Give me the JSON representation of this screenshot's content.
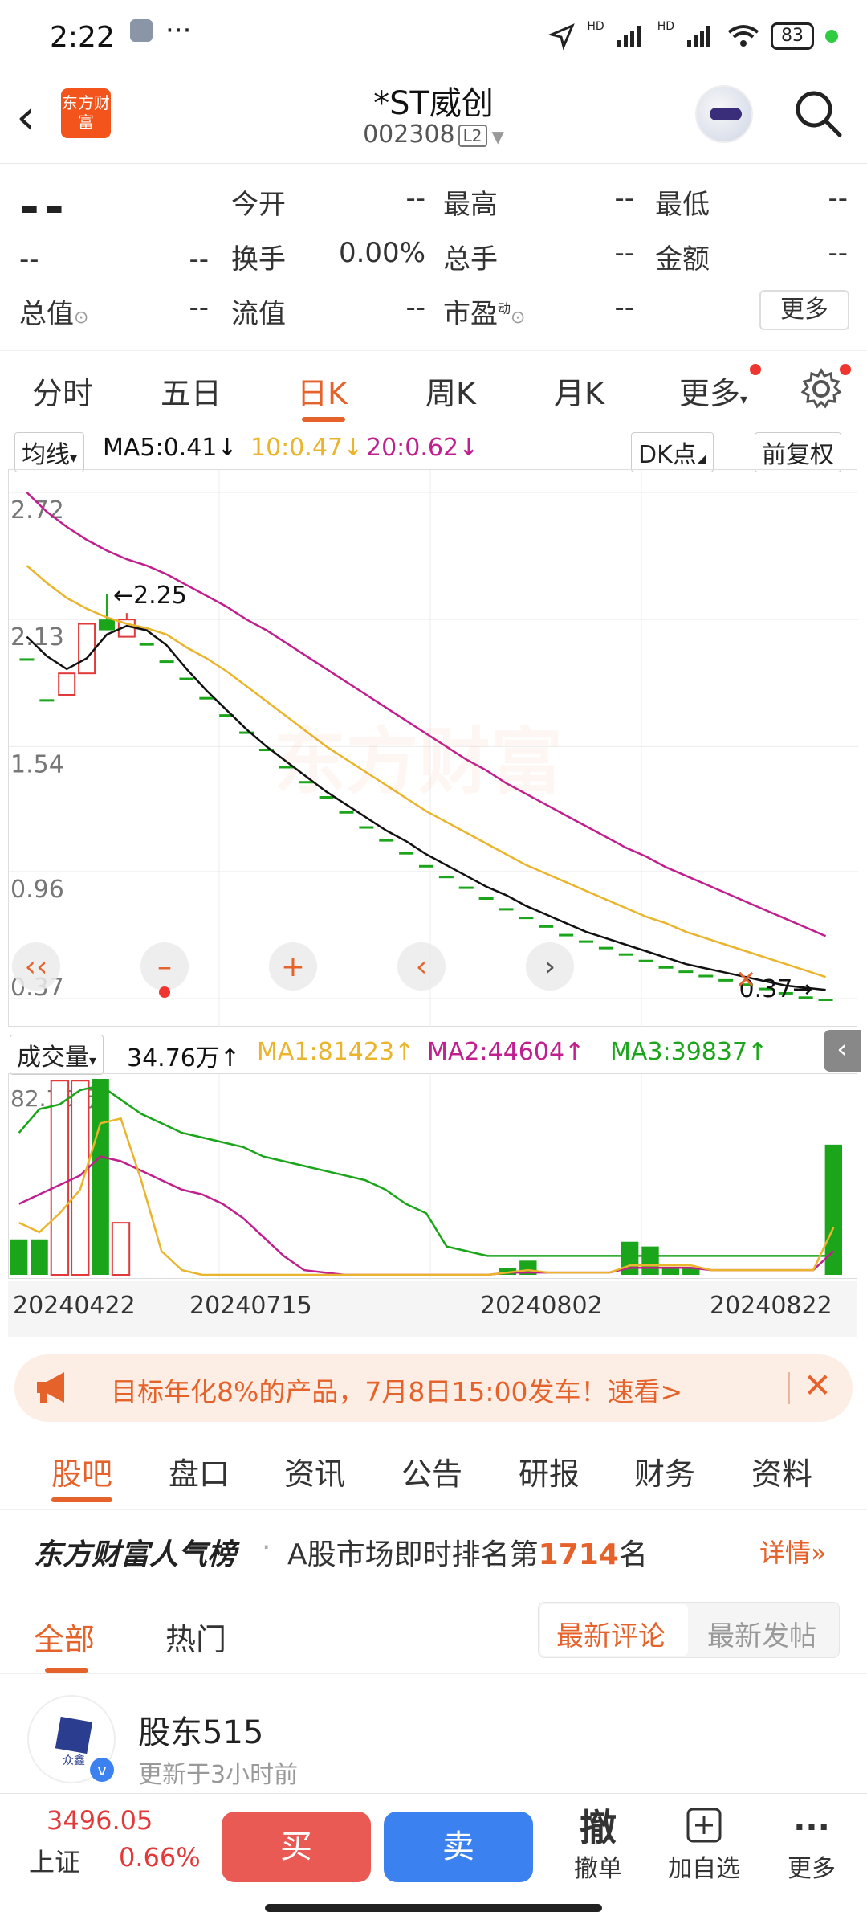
{
  "status": {
    "time": "2:22",
    "dots": "···",
    "battery": "83",
    "hd1": "HD",
    "hd2": "HD"
  },
  "header": {
    "title": "*ST威创",
    "code": "002308",
    "level": "L2",
    "logo_text": "东方财富"
  },
  "quote": {
    "price": "--",
    "change": "--",
    "change_pct": "--",
    "open_label": "今开",
    "open": "--",
    "high_label": "最高",
    "high": "--",
    "low_label": "最低",
    "low": "--",
    "turnover_label": "换手",
    "turnover": "0.00%",
    "volume_label": "总手",
    "volume": "--",
    "amount_label": "金额",
    "amount": "--",
    "mktcap_label": "总值",
    "mktcap": "--",
    "float_label": "流值",
    "float": "--",
    "pe_label": "市盈",
    "pe_sup": "动",
    "pe": "--",
    "more": "更多"
  },
  "tabs": [
    "分时",
    "五日",
    "日K",
    "周K",
    "月K",
    "更多"
  ],
  "active_tab": "日K",
  "ma": {
    "selector": "均线",
    "ma5": "MA5:0.41",
    "ma10": "10:0.47",
    "ma20": "20:0.62",
    "dk": "DK点",
    "adjust": "前复权"
  },
  "volume_ind": {
    "selector": "成交量",
    "vol": "34.76万",
    "ma1": "MA1:81423",
    "ma2": "MA2:44604",
    "ma3": "MA3:39837",
    "max_label": "82.76万"
  },
  "colors": {
    "accent": "#e6622b",
    "up": "#e2393a",
    "down": "#1aa51a",
    "ma5": "#111111",
    "ma10": "#eab52c",
    "ma20": "#c0208e"
  },
  "chart_data": {
    "type": "candlestick",
    "y_ticks": [
      "2.72",
      "2.13",
      "1.54",
      "0.96",
      "0.37"
    ],
    "ylim": [
      0.37,
      2.72
    ],
    "high_marker": "2.25",
    "low_marker": "0.37",
    "x_dates": [
      "20240422",
      "20240715",
      "20240802",
      "20240822"
    ],
    "candles": [
      {
        "o": 1.95,
        "c": 1.95,
        "h": 1.95,
        "l": 1.95,
        "up": false
      },
      {
        "o": 1.76,
        "c": 1.76,
        "h": 1.76,
        "l": 1.76,
        "up": false
      },
      {
        "o": 1.78,
        "c": 1.88,
        "h": 1.88,
        "l": 1.78,
        "up": true
      },
      {
        "o": 1.88,
        "c": 2.11,
        "h": 2.11,
        "l": 1.88,
        "up": true
      },
      {
        "o": 2.13,
        "c": 2.08,
        "h": 2.25,
        "l": 2.08,
        "up": false
      },
      {
        "o": 2.05,
        "c": 2.13,
        "h": 2.16,
        "l": 2.05,
        "up": true
      },
      {
        "o": 2.02,
        "c": 2.02,
        "h": 2.02,
        "l": 2.02,
        "up": false
      },
      {
        "o": 1.94,
        "c": 1.94,
        "h": 1.94,
        "l": 1.94,
        "up": false
      },
      {
        "o": 1.86,
        "c": 1.86,
        "h": 1.86,
        "l": 1.86,
        "up": false
      },
      {
        "o": 1.77,
        "c": 1.77,
        "h": 1.77,
        "l": 1.77,
        "up": false
      },
      {
        "o": 1.69,
        "c": 1.69,
        "h": 1.69,
        "l": 1.69,
        "up": false
      },
      {
        "o": 1.61,
        "c": 1.61,
        "h": 1.61,
        "l": 1.61,
        "up": false
      },
      {
        "o": 1.53,
        "c": 1.53,
        "h": 1.53,
        "l": 1.53,
        "up": false
      },
      {
        "o": 1.45,
        "c": 1.45,
        "h": 1.45,
        "l": 1.45,
        "up": false
      },
      {
        "o": 1.38,
        "c": 1.38,
        "h": 1.38,
        "l": 1.38,
        "up": false
      },
      {
        "o": 1.31,
        "c": 1.31,
        "h": 1.31,
        "l": 1.31,
        "up": false
      },
      {
        "o": 1.24,
        "c": 1.24,
        "h": 1.24,
        "l": 1.24,
        "up": false
      },
      {
        "o": 1.17,
        "c": 1.17,
        "h": 1.17,
        "l": 1.17,
        "up": false
      },
      {
        "o": 1.11,
        "c": 1.11,
        "h": 1.11,
        "l": 1.11,
        "up": false
      },
      {
        "o": 1.05,
        "c": 1.05,
        "h": 1.05,
        "l": 1.05,
        "up": false
      },
      {
        "o": 0.99,
        "c": 0.99,
        "h": 0.99,
        "l": 0.99,
        "up": false
      },
      {
        "o": 0.94,
        "c": 0.94,
        "h": 0.94,
        "l": 0.94,
        "up": false
      },
      {
        "o": 0.89,
        "c": 0.89,
        "h": 0.89,
        "l": 0.89,
        "up": false
      },
      {
        "o": 0.84,
        "c": 0.84,
        "h": 0.84,
        "l": 0.84,
        "up": false
      },
      {
        "o": 0.79,
        "c": 0.79,
        "h": 0.79,
        "l": 0.79,
        "up": false
      },
      {
        "o": 0.75,
        "c": 0.75,
        "h": 0.75,
        "l": 0.75,
        "up": false
      },
      {
        "o": 0.71,
        "c": 0.71,
        "h": 0.71,
        "l": 0.71,
        "up": false
      },
      {
        "o": 0.67,
        "c": 0.67,
        "h": 0.67,
        "l": 0.67,
        "up": false
      },
      {
        "o": 0.64,
        "c": 0.64,
        "h": 0.64,
        "l": 0.64,
        "up": false
      },
      {
        "o": 0.61,
        "c": 0.61,
        "h": 0.61,
        "l": 0.61,
        "up": false
      },
      {
        "o": 0.58,
        "c": 0.58,
        "h": 0.58,
        "l": 0.58,
        "up": false
      },
      {
        "o": 0.55,
        "c": 0.55,
        "h": 0.55,
        "l": 0.55,
        "up": false
      },
      {
        "o": 0.52,
        "c": 0.52,
        "h": 0.52,
        "l": 0.52,
        "up": false
      },
      {
        "o": 0.5,
        "c": 0.5,
        "h": 0.5,
        "l": 0.5,
        "up": false
      },
      {
        "o": 0.48,
        "c": 0.48,
        "h": 0.48,
        "l": 0.48,
        "up": false
      },
      {
        "o": 0.46,
        "c": 0.46,
        "h": 0.46,
        "l": 0.46,
        "up": false
      },
      {
        "o": 0.44,
        "c": 0.44,
        "h": 0.44,
        "l": 0.44,
        "up": false
      },
      {
        "o": 0.42,
        "c": 0.42,
        "h": 0.42,
        "l": 0.42,
        "up": false
      },
      {
        "o": 0.4,
        "c": 0.4,
        "h": 0.4,
        "l": 0.4,
        "up": false
      },
      {
        "o": 0.38,
        "c": 0.38,
        "h": 0.38,
        "l": 0.38,
        "up": false
      },
      {
        "o": 0.37,
        "c": 0.37,
        "h": 0.37,
        "l": 0.37,
        "up": false
      }
    ],
    "ma5": [
      2.05,
      1.96,
      1.9,
      1.95,
      2.06,
      2.1,
      2.08,
      2.01,
      1.9,
      1.8,
      1.71,
      1.62,
      1.54,
      1.47,
      1.4,
      1.33,
      1.27,
      1.21,
      1.15,
      1.1,
      1.04,
      0.99,
      0.94,
      0.89,
      0.85,
      0.8,
      0.76,
      0.72,
      0.68,
      0.65,
      0.62,
      0.59,
      0.56,
      0.53,
      0.51,
      0.49,
      0.47,
      0.45,
      0.43,
      0.42,
      0.41
    ],
    "ma10": [
      2.38,
      2.3,
      2.23,
      2.18,
      2.14,
      2.11,
      2.09,
      2.06,
      2.0,
      1.95,
      1.89,
      1.82,
      1.75,
      1.68,
      1.61,
      1.54,
      1.48,
      1.42,
      1.36,
      1.3,
      1.24,
      1.19,
      1.14,
      1.09,
      1.04,
      0.99,
      0.95,
      0.91,
      0.87,
      0.83,
      0.79,
      0.75,
      0.72,
      0.68,
      0.65,
      0.62,
      0.59,
      0.56,
      0.53,
      0.5,
      0.47
    ],
    "ma20": [
      2.72,
      2.63,
      2.56,
      2.5,
      2.45,
      2.41,
      2.38,
      2.34,
      2.29,
      2.24,
      2.19,
      2.13,
      2.08,
      2.02,
      1.96,
      1.9,
      1.84,
      1.78,
      1.72,
      1.66,
      1.6,
      1.54,
      1.48,
      1.43,
      1.37,
      1.32,
      1.27,
      1.22,
      1.17,
      1.12,
      1.07,
      1.03,
      0.98,
      0.94,
      0.9,
      0.86,
      0.82,
      0.78,
      0.74,
      0.7,
      0.66
    ],
    "volume": [
      15,
      15,
      82,
      82,
      82.76,
      22,
      0,
      0,
      0,
      0,
      0,
      0,
      0,
      0,
      0,
      0,
      0,
      0,
      0,
      0,
      0,
      0,
      0,
      0,
      3,
      6,
      0,
      0,
      0,
      0,
      14,
      12,
      3,
      3,
      0,
      0,
      0,
      0,
      0,
      0,
      55
    ],
    "volume_up": [
      false,
      false,
      true,
      true,
      false,
      true,
      false,
      false,
      false,
      false,
      false,
      false,
      false,
      false,
      false,
      false,
      false,
      false,
      false,
      false,
      false,
      false,
      false,
      false,
      false,
      false,
      false,
      false,
      false,
      false,
      false,
      false,
      false,
      false,
      false,
      false,
      false,
      false,
      false,
      false,
      false
    ]
  },
  "ad": {
    "text": "目标年化8%的产品，7月8日15:00发车！速看>"
  },
  "content_tabs": [
    "股吧",
    "盘口",
    "资讯",
    "公告",
    "研报",
    "财务",
    "资料"
  ],
  "rank": {
    "brand": "东方财富人气榜",
    "text_prefix": "A股市场即时排名第",
    "rank": "1714",
    "text_suffix": "名",
    "detail": "详情"
  },
  "filters": {
    "all": "全部",
    "hot": "热门",
    "latest_comment": "最新评论",
    "latest_post": "最新发帖"
  },
  "post": {
    "author": "股东515",
    "time": "更新于3小时前",
    "avatar_mark": "众鑫"
  },
  "bottom": {
    "index_value": "3496.05",
    "index_name": "上证",
    "index_pct": "0.66%",
    "buy": "买",
    "sell": "卖",
    "cancel_icon": "撤",
    "cancel": "撤单",
    "add": "加自选",
    "more": "更多"
  }
}
